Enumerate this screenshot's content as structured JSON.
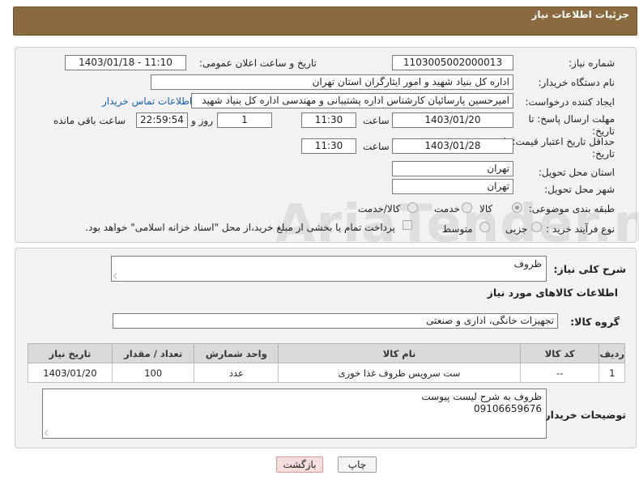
{
  "header": {
    "title": "جزئیات اطلاعات نیاز"
  },
  "fields": {
    "need_number_label": "شماره نیاز:",
    "need_number": "1103005002000013",
    "announce_label": "تاریخ و ساعت اعلان عمومی:",
    "announce_value": "1403/01/18 - 11:10",
    "buyer_label": "نام دستگاه خریدار:",
    "buyer_value": "اداره کل بنیاد شهید و امور ایثارگران استان تهران",
    "creator_label": "ایجاد کننده درخواست:",
    "creator_value": "امیرحسین پارسائیان کارشناس اداره پشتیبانی و مهندسی  اداره کل بنیاد شهید",
    "contact_link": "اطلاعات تماس خریدار",
    "reply_deadline_label_1": "مهلت ارسال پاسخ: تا",
    "reply_deadline_label_2": "تاریخ:",
    "reply_date": "1403/01/20",
    "time_label": "ساعت",
    "reply_time": "11:30",
    "days_value": "1",
    "days_label": "روز و",
    "remaining_time": "22:59:54",
    "remaining_label": "ساعت باقی مانده",
    "price_valid_label_1": "حداقل تاریخ اعتبار قیمت: تا",
    "price_valid_label_2": "تاریخ:",
    "price_valid_date": "1403/01/28",
    "price_valid_time": "11:30",
    "province_label": "استان محل تحویل:",
    "province_value": "تهران",
    "city_label": "شهر محل تحویل:",
    "city_value": "تهران",
    "category_label": "طبقه بندی موضوعی:",
    "category_options": [
      "کالا",
      "خدمت",
      "کالا/خدمت"
    ],
    "category_selected": "کالا",
    "process_label": "نوع فرآیند خرید :",
    "process_options": [
      "جزیی",
      "متوسط"
    ],
    "payment_note": "پرداخت تمام یا بخشی از مبلغ خرید،از محل \"اسناد خزانه اسلامی\" خواهد بود."
  },
  "summary": {
    "label": "شرح کلی نیاز:",
    "value": "ظروف"
  },
  "goods_info_title": "اطلاعات کالاهای مورد نیاز",
  "goods_group": {
    "label": "گروه کالا:",
    "value": "تجهیزات خانگی، اداری و صنعتی"
  },
  "table": {
    "headers": [
      "ردیف",
      "کد کالا",
      "نام کالا",
      "واحد شمارش",
      "تعداد / مقدار",
      "تاریخ نیاز"
    ],
    "rows": [
      [
        "1",
        "--",
        "ست سرویس ظروف غذا خوری",
        "عدد",
        "100",
        "1403/01/20"
      ]
    ]
  },
  "buyer_notes": {
    "label": "توضیحات خریدار:",
    "line1": "ظروف به شرح لیست پیوست",
    "line2": "09106659676"
  },
  "buttons": {
    "print": "چاپ",
    "back": "بازگشت"
  },
  "watermark": "AriaTender.neT"
}
